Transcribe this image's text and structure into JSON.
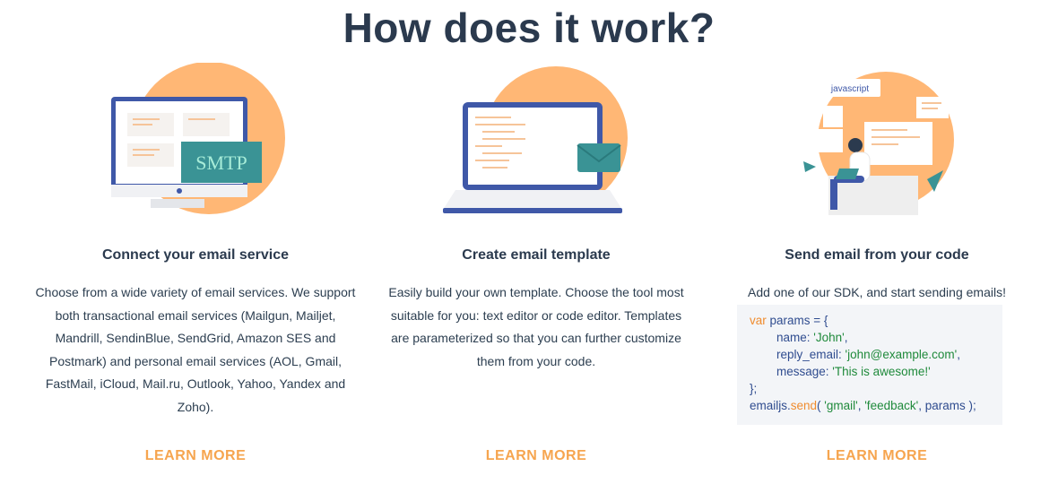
{
  "page_title": "How does it work?",
  "colors": {
    "accent": "#f6a54f",
    "circle": "#ffb775",
    "navy": "#3f58a8",
    "teal": "#3a9395"
  },
  "columns": [
    {
      "heading": "Connect your email service",
      "description": "Choose from a wide variety of email services. We support both transactional email services (Mailgun, Mailjet, Mandrill, SendinBlue, SendGrid, Amazon SES and Postmark) and personal email services (AOL, Gmail, FastMail, iCloud, Mail.ru, Outlook, Yahoo, Yandex and Zoho).",
      "illustration_label": "SMTP",
      "icon": "monitor-smtp-illustration",
      "link": "LEARN MORE"
    },
    {
      "heading": "Create email template",
      "description": "Easily build your own template. Choose the tool most suitable for you: text editor or code editor. Templates are parameterized so that you can further customize them from your code.",
      "icon": "laptop-envelope-illustration",
      "link": "LEARN MORE"
    },
    {
      "heading": "Send email from your code",
      "description": "Add one of our SDK, and start sending emails!",
      "illustration_label": "javascript",
      "icon": "developer-laptop-illustration",
      "link": "LEARN MORE",
      "code": {
        "l1_kw": "var",
        "l1_rest": " params = {",
        "l2_key": "name: ",
        "l2_val": "'John'",
        "l2_end": ",",
        "l3_key": "reply_email: ",
        "l3_val": "'john@example.com'",
        "l3_end": ",",
        "l4_key": "message: ",
        "l4_val": "'This is awesome!'",
        "l5": "};",
        "l6_obj": "emailjs.",
        "l6_fn": "send",
        "l6_open": "( ",
        "l6_a1": "'gmail'",
        "l6_c1": ", ",
        "l6_a2": "'feedback'",
        "l6_rest": ", params );"
      }
    }
  ]
}
